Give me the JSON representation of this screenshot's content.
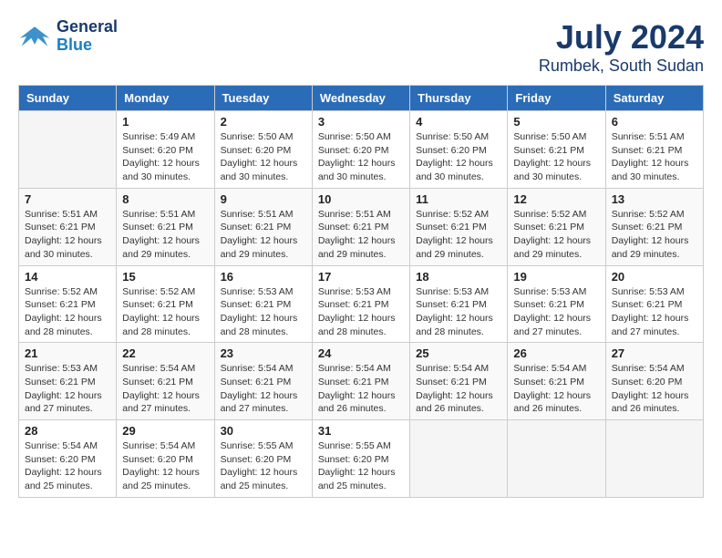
{
  "header": {
    "logo_line1": "General",
    "logo_line2": "Blue",
    "title": "July 2024",
    "subtitle": "Rumbek, South Sudan"
  },
  "columns": [
    "Sunday",
    "Monday",
    "Tuesday",
    "Wednesday",
    "Thursday",
    "Friday",
    "Saturday"
  ],
  "weeks": [
    [
      {
        "day": "",
        "info": ""
      },
      {
        "day": "1",
        "info": "Sunrise: 5:49 AM\nSunset: 6:20 PM\nDaylight: 12 hours\nand 30 minutes."
      },
      {
        "day": "2",
        "info": "Sunrise: 5:50 AM\nSunset: 6:20 PM\nDaylight: 12 hours\nand 30 minutes."
      },
      {
        "day": "3",
        "info": "Sunrise: 5:50 AM\nSunset: 6:20 PM\nDaylight: 12 hours\nand 30 minutes."
      },
      {
        "day": "4",
        "info": "Sunrise: 5:50 AM\nSunset: 6:20 PM\nDaylight: 12 hours\nand 30 minutes."
      },
      {
        "day": "5",
        "info": "Sunrise: 5:50 AM\nSunset: 6:21 PM\nDaylight: 12 hours\nand 30 minutes."
      },
      {
        "day": "6",
        "info": "Sunrise: 5:51 AM\nSunset: 6:21 PM\nDaylight: 12 hours\nand 30 minutes."
      }
    ],
    [
      {
        "day": "7",
        "info": "Sunrise: 5:51 AM\nSunset: 6:21 PM\nDaylight: 12 hours\nand 30 minutes."
      },
      {
        "day": "8",
        "info": "Sunrise: 5:51 AM\nSunset: 6:21 PM\nDaylight: 12 hours\nand 29 minutes."
      },
      {
        "day": "9",
        "info": "Sunrise: 5:51 AM\nSunset: 6:21 PM\nDaylight: 12 hours\nand 29 minutes."
      },
      {
        "day": "10",
        "info": "Sunrise: 5:51 AM\nSunset: 6:21 PM\nDaylight: 12 hours\nand 29 minutes."
      },
      {
        "day": "11",
        "info": "Sunrise: 5:52 AM\nSunset: 6:21 PM\nDaylight: 12 hours\nand 29 minutes."
      },
      {
        "day": "12",
        "info": "Sunrise: 5:52 AM\nSunset: 6:21 PM\nDaylight: 12 hours\nand 29 minutes."
      },
      {
        "day": "13",
        "info": "Sunrise: 5:52 AM\nSunset: 6:21 PM\nDaylight: 12 hours\nand 29 minutes."
      }
    ],
    [
      {
        "day": "14",
        "info": "Sunrise: 5:52 AM\nSunset: 6:21 PM\nDaylight: 12 hours\nand 28 minutes."
      },
      {
        "day": "15",
        "info": "Sunrise: 5:52 AM\nSunset: 6:21 PM\nDaylight: 12 hours\nand 28 minutes."
      },
      {
        "day": "16",
        "info": "Sunrise: 5:53 AM\nSunset: 6:21 PM\nDaylight: 12 hours\nand 28 minutes."
      },
      {
        "day": "17",
        "info": "Sunrise: 5:53 AM\nSunset: 6:21 PM\nDaylight: 12 hours\nand 28 minutes."
      },
      {
        "day": "18",
        "info": "Sunrise: 5:53 AM\nSunset: 6:21 PM\nDaylight: 12 hours\nand 28 minutes."
      },
      {
        "day": "19",
        "info": "Sunrise: 5:53 AM\nSunset: 6:21 PM\nDaylight: 12 hours\nand 27 minutes."
      },
      {
        "day": "20",
        "info": "Sunrise: 5:53 AM\nSunset: 6:21 PM\nDaylight: 12 hours\nand 27 minutes."
      }
    ],
    [
      {
        "day": "21",
        "info": "Sunrise: 5:53 AM\nSunset: 6:21 PM\nDaylight: 12 hours\nand 27 minutes."
      },
      {
        "day": "22",
        "info": "Sunrise: 5:54 AM\nSunset: 6:21 PM\nDaylight: 12 hours\nand 27 minutes."
      },
      {
        "day": "23",
        "info": "Sunrise: 5:54 AM\nSunset: 6:21 PM\nDaylight: 12 hours\nand 27 minutes."
      },
      {
        "day": "24",
        "info": "Sunrise: 5:54 AM\nSunset: 6:21 PM\nDaylight: 12 hours\nand 26 minutes."
      },
      {
        "day": "25",
        "info": "Sunrise: 5:54 AM\nSunset: 6:21 PM\nDaylight: 12 hours\nand 26 minutes."
      },
      {
        "day": "26",
        "info": "Sunrise: 5:54 AM\nSunset: 6:21 PM\nDaylight: 12 hours\nand 26 minutes."
      },
      {
        "day": "27",
        "info": "Sunrise: 5:54 AM\nSunset: 6:20 PM\nDaylight: 12 hours\nand 26 minutes."
      }
    ],
    [
      {
        "day": "28",
        "info": "Sunrise: 5:54 AM\nSunset: 6:20 PM\nDaylight: 12 hours\nand 25 minutes."
      },
      {
        "day": "29",
        "info": "Sunrise: 5:54 AM\nSunset: 6:20 PM\nDaylight: 12 hours\nand 25 minutes."
      },
      {
        "day": "30",
        "info": "Sunrise: 5:55 AM\nSunset: 6:20 PM\nDaylight: 12 hours\nand 25 minutes."
      },
      {
        "day": "31",
        "info": "Sunrise: 5:55 AM\nSunset: 6:20 PM\nDaylight: 12 hours\nand 25 minutes."
      },
      {
        "day": "",
        "info": ""
      },
      {
        "day": "",
        "info": ""
      },
      {
        "day": "",
        "info": ""
      }
    ]
  ]
}
